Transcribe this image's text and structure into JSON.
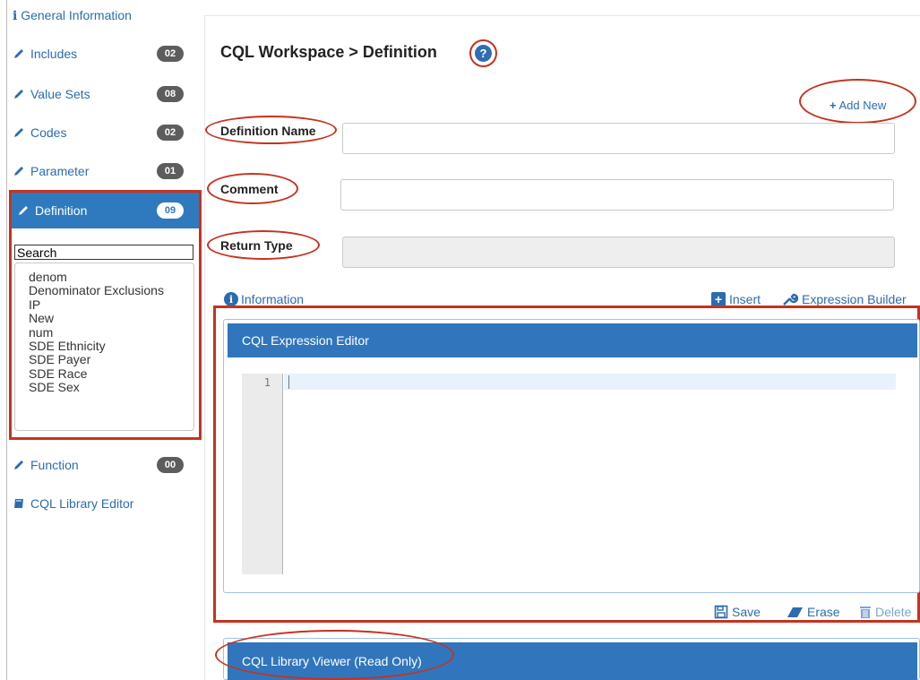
{
  "sidebar": {
    "general_info": "General Information",
    "items": [
      {
        "label": "Includes",
        "badge": "02"
      },
      {
        "label": "Value Sets",
        "badge": "08"
      },
      {
        "label": "Codes",
        "badge": "02"
      },
      {
        "label": "Parameter",
        "badge": "01"
      },
      {
        "label": "Definition",
        "badge": "09"
      },
      {
        "label": "Function",
        "badge": "00"
      }
    ],
    "library_editor": "CQL Library Editor",
    "search_value": "Search",
    "definitions": [
      "denom",
      "Denominator Exclusions",
      "IP",
      "New",
      "num",
      "SDE Ethnicity",
      "SDE Payer",
      "SDE Race",
      "SDE Sex"
    ]
  },
  "main": {
    "title": "CQL Workspace > Definition",
    "help_icon": "?",
    "add_new": "Add New",
    "fields": {
      "definition_name": "Definition Name",
      "comment": "Comment",
      "return_type": "Return Type"
    },
    "links": {
      "information": "Information",
      "insert": "Insert",
      "expression_builder": "Expression Builder"
    },
    "editor": {
      "header": "CQL Expression Editor",
      "line_number": "1"
    },
    "actions": {
      "save": "Save",
      "erase": "Erase",
      "delete": "Delete"
    },
    "viewer_header": "CQL Library Viewer (Read Only)"
  },
  "colors": {
    "accent": "#3176bc",
    "link": "#2b6cb0",
    "annotation": "#c5331f",
    "badge": "#5d5d5d"
  }
}
